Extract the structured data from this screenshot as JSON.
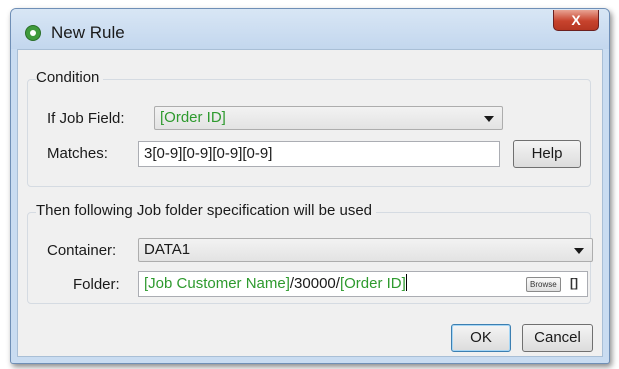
{
  "dialog": {
    "title": "New Rule",
    "close_label": "X"
  },
  "condition": {
    "group_title": "Condition",
    "job_field_label": "If Job Field:",
    "job_field_value": "[Order ID]",
    "matches_label": "Matches:",
    "matches_value": "3[0-9][0-9][0-9][0-9]",
    "help_label": "Help"
  },
  "spec": {
    "group_title": "Then following Job folder specification will be used",
    "container_label": "Container:",
    "container_value": "DATA1",
    "folder_label": "Folder:",
    "folder_parts": {
      "customer": "[Job Customer Name]",
      "sep1": "/30000/",
      "order": "[Order ID]"
    },
    "browse_label": "Browse",
    "brackets_label": "[]"
  },
  "buttons": {
    "ok": "OK",
    "cancel": "Cancel"
  },
  "colors": {
    "field_token": "#2e9a2e",
    "titlebar": "#c9dcf1",
    "close": "#c7432d"
  }
}
